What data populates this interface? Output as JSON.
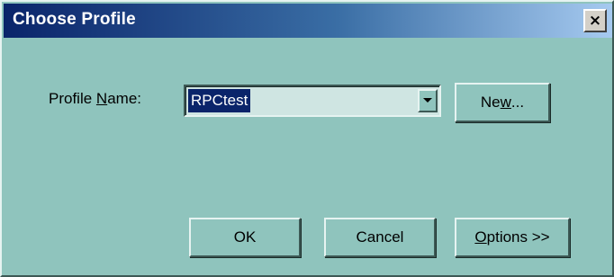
{
  "window": {
    "title": "Choose Profile",
    "close_label": "×",
    "background": "#8fc4bd",
    "titlebar_colors": [
      "#0a246a",
      "#a6caf0"
    ]
  },
  "profile": {
    "label_before": "Profile ",
    "label_mnemonic": "N",
    "label_after": "ame:",
    "selected_value": "RPCtest",
    "selection_color": "#0a246a"
  },
  "buttons": {
    "new_before": "Ne",
    "new_mnemonic": "w",
    "new_after": "...",
    "ok": "OK",
    "cancel": "Cancel",
    "options_mnemonic": "O",
    "options_after": "ptions >>"
  },
  "icons": {
    "close": "close-icon",
    "dropdown": "chevron-down-icon"
  }
}
